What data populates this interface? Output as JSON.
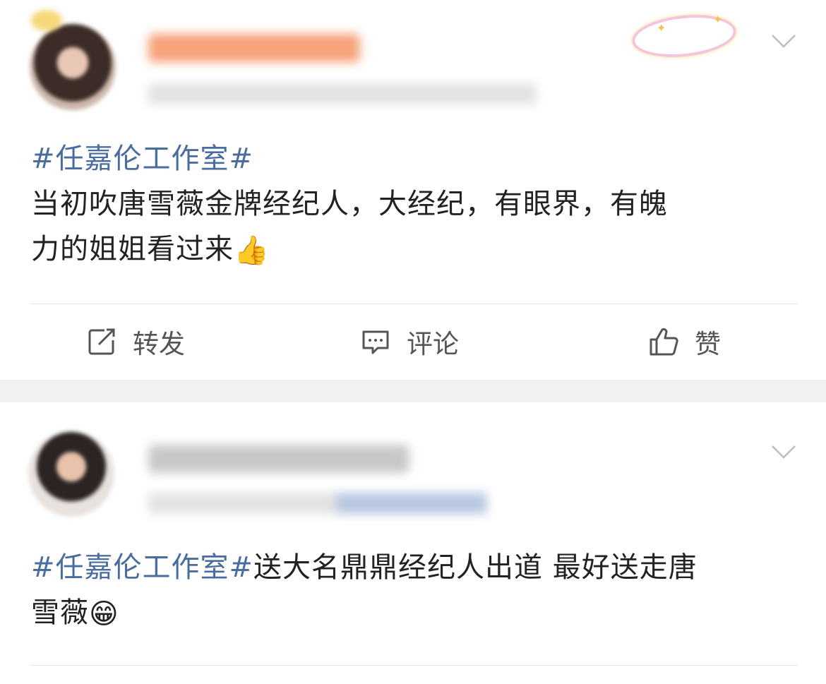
{
  "posts": [
    {
      "hashtag": "#任嘉伦工作室#",
      "text_line1": "当初吹唐雪薇金牌经纪人，大经纪，有眼界，有魄",
      "text_line2": "力的姐姐看过来",
      "emoji": "👍",
      "actions": {
        "repost_label": "转发",
        "comment_label": "评论",
        "like_label": "赞"
      }
    },
    {
      "hashtag": "#任嘉伦工作室#",
      "text_line1": "送大名鼎鼎经纪人出道 最好送走唐",
      "text_line2": "雪薇",
      "emoji": "😁"
    }
  ],
  "icons": {
    "repost": "repost-icon",
    "comment": "comment-icon",
    "like": "thumbs-up-icon",
    "menu": "chevron-down-icon"
  },
  "colors": {
    "hashtag": "#4a6da0",
    "text": "#222222",
    "action_text": "#555555",
    "separator": "#f1f1f1"
  }
}
